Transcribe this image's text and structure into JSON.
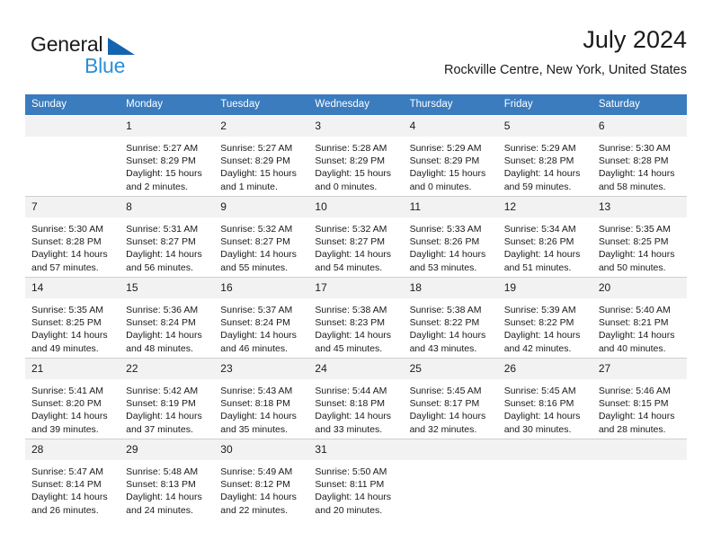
{
  "brand": {
    "word1": "General",
    "word2": "Blue",
    "triangle_color": "#1464af",
    "blue_color": "#2b8fd8"
  },
  "header": {
    "title": "July 2024",
    "location": "Rockville Centre, New York, United States"
  },
  "theme": {
    "header_row_bg": "#3a7cbe",
    "daynum_bg": "#f2f2f2",
    "text": "#1a1a1a",
    "rule": "#cfcfcf"
  },
  "columns": [
    "Sunday",
    "Monday",
    "Tuesday",
    "Wednesday",
    "Thursday",
    "Friday",
    "Saturday"
  ],
  "weeks": [
    [
      {
        "day": "",
        "sunrise": "",
        "sunset": "",
        "daylight1": "",
        "daylight2": ""
      },
      {
        "day": "1",
        "sunrise": "Sunrise: 5:27 AM",
        "sunset": "Sunset: 8:29 PM",
        "daylight1": "Daylight: 15 hours",
        "daylight2": "and 2 minutes."
      },
      {
        "day": "2",
        "sunrise": "Sunrise: 5:27 AM",
        "sunset": "Sunset: 8:29 PM",
        "daylight1": "Daylight: 15 hours",
        "daylight2": "and 1 minute."
      },
      {
        "day": "3",
        "sunrise": "Sunrise: 5:28 AM",
        "sunset": "Sunset: 8:29 PM",
        "daylight1": "Daylight: 15 hours",
        "daylight2": "and 0 minutes."
      },
      {
        "day": "4",
        "sunrise": "Sunrise: 5:29 AM",
        "sunset": "Sunset: 8:29 PM",
        "daylight1": "Daylight: 15 hours",
        "daylight2": "and 0 minutes."
      },
      {
        "day": "5",
        "sunrise": "Sunrise: 5:29 AM",
        "sunset": "Sunset: 8:28 PM",
        "daylight1": "Daylight: 14 hours",
        "daylight2": "and 59 minutes."
      },
      {
        "day": "6",
        "sunrise": "Sunrise: 5:30 AM",
        "sunset": "Sunset: 8:28 PM",
        "daylight1": "Daylight: 14 hours",
        "daylight2": "and 58 minutes."
      }
    ],
    [
      {
        "day": "7",
        "sunrise": "Sunrise: 5:30 AM",
        "sunset": "Sunset: 8:28 PM",
        "daylight1": "Daylight: 14 hours",
        "daylight2": "and 57 minutes."
      },
      {
        "day": "8",
        "sunrise": "Sunrise: 5:31 AM",
        "sunset": "Sunset: 8:27 PM",
        "daylight1": "Daylight: 14 hours",
        "daylight2": "and 56 minutes."
      },
      {
        "day": "9",
        "sunrise": "Sunrise: 5:32 AM",
        "sunset": "Sunset: 8:27 PM",
        "daylight1": "Daylight: 14 hours",
        "daylight2": "and 55 minutes."
      },
      {
        "day": "10",
        "sunrise": "Sunrise: 5:32 AM",
        "sunset": "Sunset: 8:27 PM",
        "daylight1": "Daylight: 14 hours",
        "daylight2": "and 54 minutes."
      },
      {
        "day": "11",
        "sunrise": "Sunrise: 5:33 AM",
        "sunset": "Sunset: 8:26 PM",
        "daylight1": "Daylight: 14 hours",
        "daylight2": "and 53 minutes."
      },
      {
        "day": "12",
        "sunrise": "Sunrise: 5:34 AM",
        "sunset": "Sunset: 8:26 PM",
        "daylight1": "Daylight: 14 hours",
        "daylight2": "and 51 minutes."
      },
      {
        "day": "13",
        "sunrise": "Sunrise: 5:35 AM",
        "sunset": "Sunset: 8:25 PM",
        "daylight1": "Daylight: 14 hours",
        "daylight2": "and 50 minutes."
      }
    ],
    [
      {
        "day": "14",
        "sunrise": "Sunrise: 5:35 AM",
        "sunset": "Sunset: 8:25 PM",
        "daylight1": "Daylight: 14 hours",
        "daylight2": "and 49 minutes."
      },
      {
        "day": "15",
        "sunrise": "Sunrise: 5:36 AM",
        "sunset": "Sunset: 8:24 PM",
        "daylight1": "Daylight: 14 hours",
        "daylight2": "and 48 minutes."
      },
      {
        "day": "16",
        "sunrise": "Sunrise: 5:37 AM",
        "sunset": "Sunset: 8:24 PM",
        "daylight1": "Daylight: 14 hours",
        "daylight2": "and 46 minutes."
      },
      {
        "day": "17",
        "sunrise": "Sunrise: 5:38 AM",
        "sunset": "Sunset: 8:23 PM",
        "daylight1": "Daylight: 14 hours",
        "daylight2": "and 45 minutes."
      },
      {
        "day": "18",
        "sunrise": "Sunrise: 5:38 AM",
        "sunset": "Sunset: 8:22 PM",
        "daylight1": "Daylight: 14 hours",
        "daylight2": "and 43 minutes."
      },
      {
        "day": "19",
        "sunrise": "Sunrise: 5:39 AM",
        "sunset": "Sunset: 8:22 PM",
        "daylight1": "Daylight: 14 hours",
        "daylight2": "and 42 minutes."
      },
      {
        "day": "20",
        "sunrise": "Sunrise: 5:40 AM",
        "sunset": "Sunset: 8:21 PM",
        "daylight1": "Daylight: 14 hours",
        "daylight2": "and 40 minutes."
      }
    ],
    [
      {
        "day": "21",
        "sunrise": "Sunrise: 5:41 AM",
        "sunset": "Sunset: 8:20 PM",
        "daylight1": "Daylight: 14 hours",
        "daylight2": "and 39 minutes."
      },
      {
        "day": "22",
        "sunrise": "Sunrise: 5:42 AM",
        "sunset": "Sunset: 8:19 PM",
        "daylight1": "Daylight: 14 hours",
        "daylight2": "and 37 minutes."
      },
      {
        "day": "23",
        "sunrise": "Sunrise: 5:43 AM",
        "sunset": "Sunset: 8:18 PM",
        "daylight1": "Daylight: 14 hours",
        "daylight2": "and 35 minutes."
      },
      {
        "day": "24",
        "sunrise": "Sunrise: 5:44 AM",
        "sunset": "Sunset: 8:18 PM",
        "daylight1": "Daylight: 14 hours",
        "daylight2": "and 33 minutes."
      },
      {
        "day": "25",
        "sunrise": "Sunrise: 5:45 AM",
        "sunset": "Sunset: 8:17 PM",
        "daylight1": "Daylight: 14 hours",
        "daylight2": "and 32 minutes."
      },
      {
        "day": "26",
        "sunrise": "Sunrise: 5:45 AM",
        "sunset": "Sunset: 8:16 PM",
        "daylight1": "Daylight: 14 hours",
        "daylight2": "and 30 minutes."
      },
      {
        "day": "27",
        "sunrise": "Sunrise: 5:46 AM",
        "sunset": "Sunset: 8:15 PM",
        "daylight1": "Daylight: 14 hours",
        "daylight2": "and 28 minutes."
      }
    ],
    [
      {
        "day": "28",
        "sunrise": "Sunrise: 5:47 AM",
        "sunset": "Sunset: 8:14 PM",
        "daylight1": "Daylight: 14 hours",
        "daylight2": "and 26 minutes."
      },
      {
        "day": "29",
        "sunrise": "Sunrise: 5:48 AM",
        "sunset": "Sunset: 8:13 PM",
        "daylight1": "Daylight: 14 hours",
        "daylight2": "and 24 minutes."
      },
      {
        "day": "30",
        "sunrise": "Sunrise: 5:49 AM",
        "sunset": "Sunset: 8:12 PM",
        "daylight1": "Daylight: 14 hours",
        "daylight2": "and 22 minutes."
      },
      {
        "day": "31",
        "sunrise": "Sunrise: 5:50 AM",
        "sunset": "Sunset: 8:11 PM",
        "daylight1": "Daylight: 14 hours",
        "daylight2": "and 20 minutes."
      },
      {
        "day": "",
        "sunrise": "",
        "sunset": "",
        "daylight1": "",
        "daylight2": ""
      },
      {
        "day": "",
        "sunrise": "",
        "sunset": "",
        "daylight1": "",
        "daylight2": ""
      },
      {
        "day": "",
        "sunrise": "",
        "sunset": "",
        "daylight1": "",
        "daylight2": ""
      }
    ]
  ]
}
